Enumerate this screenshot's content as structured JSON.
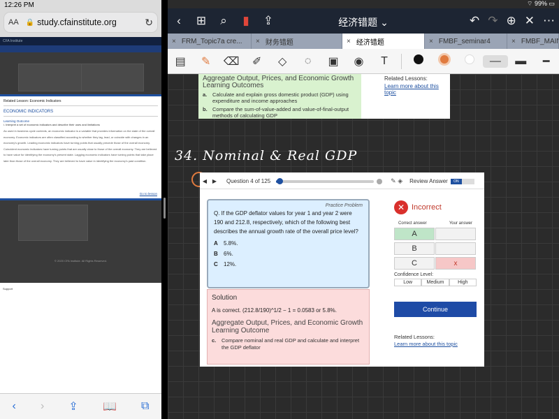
{
  "status_left": {
    "time": "12:26 PM"
  },
  "safari": {
    "aa": "AA",
    "url": "study.cfainstitute.org",
    "header_text": "CFA Institute",
    "popup": {
      "header": "Related Lesson: Economic Indicators",
      "title": "ECONOMIC INDICATORS",
      "learning_outcome_label": "Learning Outcome",
      "learning_outcome": "i.   Interpret a set of economic indicators and describe their uses and limitations",
      "body": "As used in business cycle contexts, an economic indicator is a variable that provides information on the state of the overall economy. Economic indicators are often classified according to whether they lag, lead, or coincide with changes in an economy's growth. Leading economic indicators have turning points that usually precede those of the overall economy. Coincident economic indicators have turning points that are usually close to those of the overall economy. They are believed to have value for identifying the economy's present state. Lagging economic indicators have turning points that take place later than those of the overall economy. They are believed to have value in identifying the economy's past condition.",
      "goto": "Go to lesson"
    },
    "footer": "© 2020 CFA Institute. All Rights Reserved.",
    "support": "Support"
  },
  "status_right": {
    "battery": "99%"
  },
  "notes": {
    "title": "经济错题",
    "tabs": [
      "FRM_Topic7a cre...",
      "财务错题",
      "经济错题",
      "FMBF_seminar4",
      "FMBF_MAIN_"
    ]
  },
  "top_card": {
    "heading": "Aggregate Output, Prices, and Economic Growth Learning Outcomes",
    "items": [
      {
        "letter": "a.",
        "text": "Calculate and explain gross domestic product (GDP) using expenditure and income approaches"
      },
      {
        "letter": "b.",
        "text": "Compare the sum-of-value-added and value-of-final-output methods of calculating GDP"
      }
    ],
    "related_label": "Related Lessons:",
    "related_link": "Learn more about this topic"
  },
  "handwriting": "34. Nominal & Real GDP",
  "question": {
    "nav_label": "Question 4 of 125",
    "progress": 0.032,
    "review_label": "Review Answer",
    "toggle": "ON",
    "practice_label": "Practice Problem",
    "prompt": "Q. If the GDP deflator values for year 1 and year 2 were 190 and 212.8, respectively, which of the following best describes the annual growth rate of the overall price level?",
    "options": [
      {
        "letter": "A",
        "text": "5.8%."
      },
      {
        "letter": "B",
        "text": "6%."
      },
      {
        "letter": "C",
        "text": "12%."
      }
    ],
    "solution_title": "Solution",
    "solution_answer": "A is correct. (212.8/190)^1/2 − 1 = 0.0583 or 5.8%.",
    "solution_heading": "Aggregate Output, Prices, and Economic Growth Learning Outcome",
    "solution_item": {
      "letter": "c.",
      "text": "Compare nominal and real GDP and calculate and interpret the GDP deflator"
    }
  },
  "result": {
    "status": "Incorrect",
    "col_correct": "Correct answer",
    "col_yours": "Your answer",
    "rows": [
      {
        "correct": "A",
        "yours": ""
      },
      {
        "correct": "B",
        "yours": ""
      },
      {
        "correct": "C",
        "yours": "x"
      }
    ],
    "confidence_label": "Confidence Level:",
    "confidence": [
      "Low",
      "Medium",
      "High"
    ],
    "continue": "Continue",
    "related_label": "Related Lessons:",
    "related_link": "Learn more about this topic"
  },
  "colors": {
    "accent": "#1e4ba6",
    "incorrect": "#d9302c",
    "correct_fill": "#bfe5c8",
    "pen_orange": "#e07a3e"
  }
}
